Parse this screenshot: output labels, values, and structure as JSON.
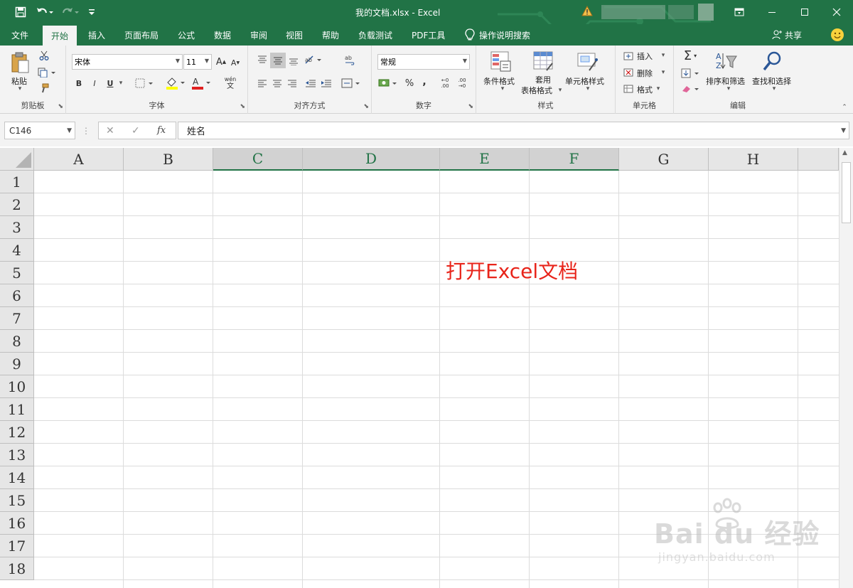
{
  "window": {
    "doc_title": "我的文档.xlsx  -  Excel",
    "warning_icon": "warning-icon"
  },
  "quick_access": {
    "save_icon": "save-icon",
    "undo_icon": "undo-icon",
    "redo_icon": "redo-icon",
    "customize_icon": "customize-icon"
  },
  "tabs": [
    {
      "label": "文件"
    },
    {
      "label": "开始",
      "active": true
    },
    {
      "label": "插入"
    },
    {
      "label": "页面布局"
    },
    {
      "label": "公式"
    },
    {
      "label": "数据"
    },
    {
      "label": "审阅"
    },
    {
      "label": "视图"
    },
    {
      "label": "帮助"
    },
    {
      "label": "负载测试"
    },
    {
      "label": "PDF工具"
    }
  ],
  "tell_me": "操作说明搜索",
  "share": "共享",
  "ribbon": {
    "clipboard": {
      "label": "剪贴板",
      "paste": "粘贴"
    },
    "font": {
      "label": "字体",
      "font_name": "宋体",
      "font_size": "11",
      "bold": "B",
      "italic": "I",
      "underline": "U",
      "grow": "A",
      "shrink": "A",
      "wen": "wén",
      "wen2": "文",
      "font_color": "A"
    },
    "alignment": {
      "label": "对齐方式"
    },
    "number": {
      "label": "数字",
      "format": "常规",
      "percent": "%",
      "comma": ",",
      "inc": "←0 .00",
      "dec": ".00 →0"
    },
    "styles": {
      "label": "样式",
      "conditional": "条件格式",
      "table1": "套用",
      "table2": "表格格式",
      "cell": "单元格样式"
    },
    "cells": {
      "label": "单元格",
      "insert": "插入",
      "delete": "删除",
      "format": "格式"
    },
    "editing": {
      "label": "编辑",
      "sort": "排序和筛选",
      "find": "查找和选择",
      "sigma": "Σ"
    }
  },
  "formula_bar": {
    "name_box": "C146",
    "cancel": "✕",
    "enter": "✓",
    "fx": "fx",
    "value": "姓名"
  },
  "sheet": {
    "columns": [
      "A",
      "B",
      "C",
      "D",
      "E",
      "F",
      "G",
      "H"
    ],
    "selected_columns": [
      "C",
      "D",
      "E",
      "F"
    ],
    "rows": [
      "1",
      "2",
      "3",
      "4",
      "5",
      "6",
      "7",
      "8",
      "9",
      "10",
      "11",
      "12",
      "13",
      "14",
      "15",
      "16",
      "17",
      "18"
    ],
    "annotation": "打开Excel文档"
  },
  "watermark": {
    "text": "Bai du 经验",
    "url": "jingyan.baidu.com"
  }
}
